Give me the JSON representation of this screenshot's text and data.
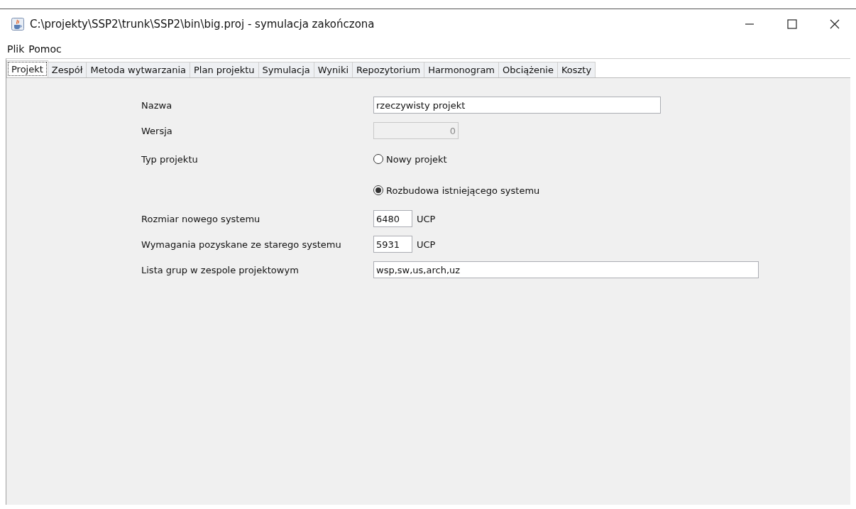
{
  "window": {
    "title": "C:\\projekty\\SSP2\\trunk\\SSP2\\bin\\big.proj - symulacja zakończona"
  },
  "menu": [
    "Plik",
    "Pomoc"
  ],
  "tabs": [
    {
      "label": "Projekt",
      "selected": true
    },
    {
      "label": "Zespół",
      "selected": false
    },
    {
      "label": "Metoda wytwarzania",
      "selected": false
    },
    {
      "label": "Plan projektu",
      "selected": false
    },
    {
      "label": "Symulacja",
      "selected": false
    },
    {
      "label": "Wyniki",
      "selected": false
    },
    {
      "label": "Repozytorium",
      "selected": false
    },
    {
      "label": "Harmonogram",
      "selected": false
    },
    {
      "label": "Obciążenie",
      "selected": false
    },
    {
      "label": "Koszty",
      "selected": false
    }
  ],
  "form": [
    {
      "kind": "text",
      "label": "Nazwa",
      "value": "rzeczywisty projekt",
      "disabled": false
    },
    {
      "kind": "number",
      "label": "Wersja",
      "value": "0",
      "disabled": true
    },
    {
      "kind": "radio",
      "label": "Typ projektu",
      "options": [
        {
          "label": "Nowy projekt",
          "selected": false
        },
        {
          "label": "Rozbudowa istniejącego systemu",
          "selected": true
        }
      ]
    },
    {
      "kind": "unit",
      "label": "Rozmiar nowego systemu",
      "value": "6480",
      "unit": "UCP"
    },
    {
      "kind": "unit",
      "label": "Wymagania pozyskane ze starego systemu",
      "value": "5931",
      "unit": "UCP"
    },
    {
      "kind": "text",
      "label": "Lista grup w zespole projektowym",
      "value": "wsp,sw,us,arch,uz",
      "disabled": false
    }
  ]
}
